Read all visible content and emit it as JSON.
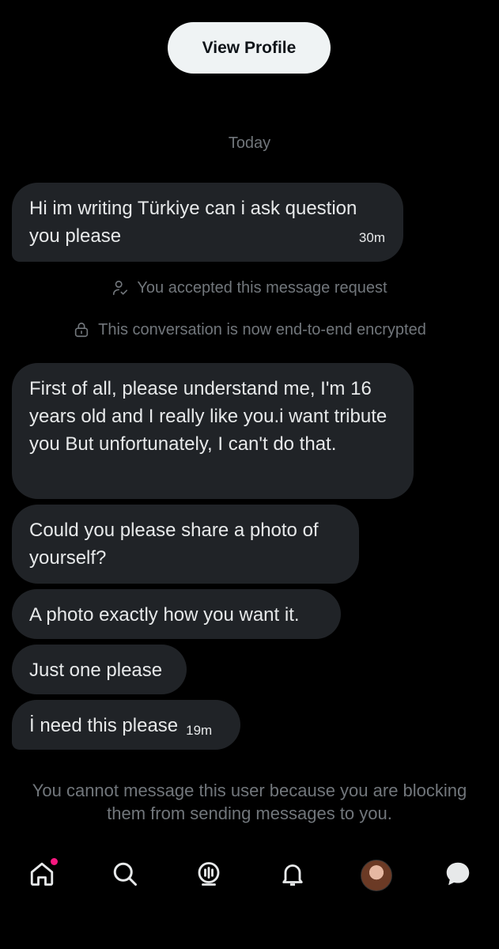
{
  "header": {
    "view_profile_label": "View Profile"
  },
  "conversation": {
    "date_label": "Today",
    "messages": [
      {
        "text": "Hi im writing Türkiye can i ask question you please",
        "time": "30m"
      },
      {
        "text": "First of all, please understand me, I'm 16 years old and I really like you.i want tribute you But unfortunately, I can't do that."
      },
      {
        "text": "Could you please share a photo of yourself?"
      },
      {
        "text": "A photo exactly how you want it."
      },
      {
        "text": "Just one please"
      },
      {
        "text": "İ need this please",
        "time": "19m"
      }
    ],
    "system_notices": {
      "accepted": "You accepted this message request",
      "encrypted": "This conversation is now end-to-end encrypted"
    },
    "blocked_notice": "You cannot message this user because you are blocking them from sending messages to you."
  },
  "nav": {
    "items": [
      {
        "icon": "home-icon",
        "has_notification": true
      },
      {
        "icon": "search-icon"
      },
      {
        "icon": "grok-icon"
      },
      {
        "icon": "bell-icon"
      },
      {
        "icon": "profile-avatar"
      },
      {
        "icon": "messages-icon"
      }
    ]
  },
  "colors": {
    "background": "#000000",
    "bubble": "#202327",
    "muted_text": "#71767b",
    "notification_dot": "#f91880"
  }
}
